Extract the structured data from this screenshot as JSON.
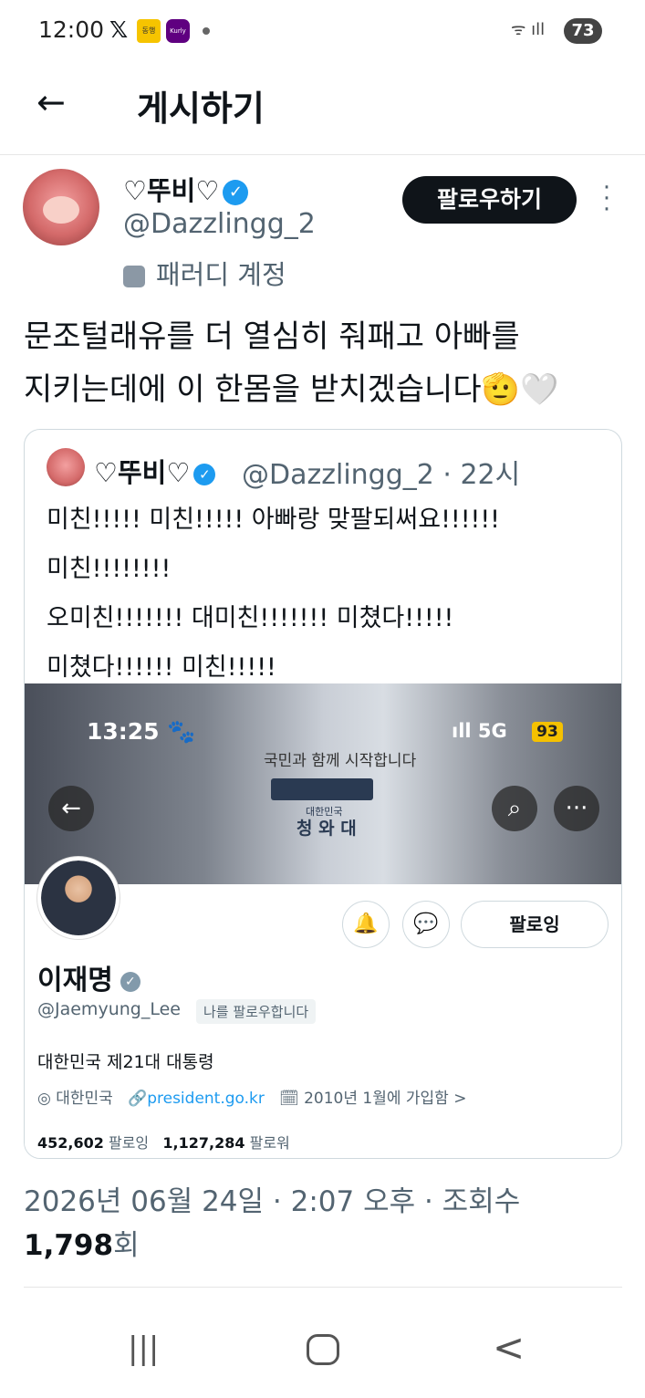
{
  "status_bar": {
    "time": "12:00",
    "x_logo": "𝕏",
    "app1": "동행",
    "app2": "Kurly",
    "battery": "73",
    "signal": "ᯤ ıll"
  },
  "header": {
    "back": "←",
    "title": "게시하기"
  },
  "post": {
    "display_name": "♡뚜비♡",
    "handle": "@Dazzlingg_2",
    "parody_label": "패러디 계정",
    "follow_label": "팔로우하기",
    "text_line1": "문조털래유를 더 열심히 줘패고 아빠를",
    "text_line2": "지키는데에 이 한몸을 받치겠습니다🫡🤍",
    "timestamp": "2026년 06월 24일 · 2:07 오후 · 조회수",
    "views_count": "1,798",
    "views_suffix": "회"
  },
  "quoted": {
    "display_name": "♡뚜비♡",
    "handle_time": "@Dazzlingg_2 · 22시",
    "line1": "미친!!!!! 미친!!!!! 아빠랑 맞팔되써요!!!!!!",
    "line2": "미친!!!!!!!!",
    "line3": "오미친!!!!!!! 대미친!!!!!!! 미쳤다!!!!!",
    "line4": "미쳤다!!!!!! 미친!!!!!"
  },
  "embedded_profile": {
    "status_time": "13:25 🐾",
    "status_signal": "ıll 5G",
    "status_badge": "93",
    "banner_slogan": "국민과 함께 시작합니다",
    "banner_kr": "대한민국",
    "banner_cheong": "청 와 대",
    "name": "이재명",
    "handle": "@Jaemyung_Lee",
    "follows_you": "나를 팔로우합니다",
    "bio": "대한민국 제21대 대통령",
    "location": "◎ 대한민국",
    "link": "president.go.kr",
    "joined": "🗓 2010년 1월에 가입함 >",
    "following_count": "452,602",
    "following_label": "팔로잉",
    "followers_count": "1,127,284",
    "followers_label": "팔로워",
    "following_button": "팔로잉"
  },
  "nav": {
    "recent": "|||",
    "back": "<"
  }
}
